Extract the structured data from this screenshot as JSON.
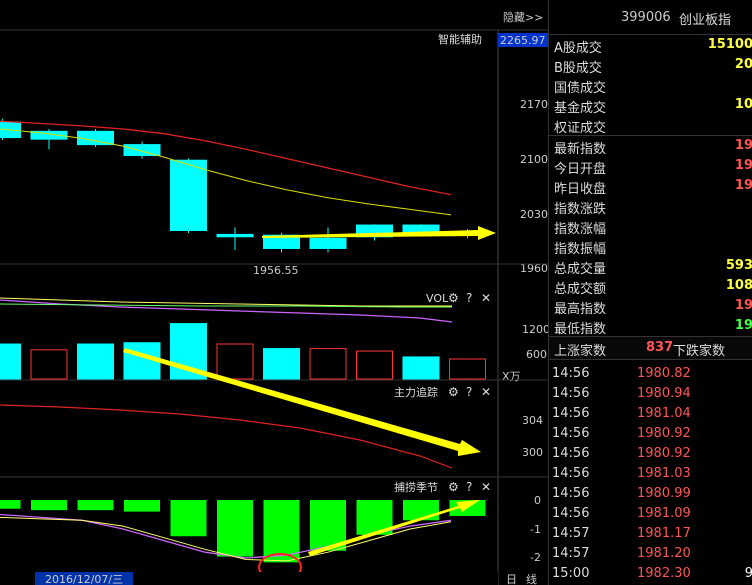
{
  "top": {
    "hide_label": "隐藏>>"
  },
  "main_panel": {
    "title": "智能辅助",
    "price_badge": "2265.97",
    "y_ticks": [
      "2170",
      "2100",
      "2030",
      "1960"
    ],
    "low_label": "1956.55"
  },
  "vol_panel": {
    "title": "VOL",
    "y_ticks": [
      "1200",
      "600"
    ],
    "unit": "X万"
  },
  "track_panel": {
    "title": "主力追踪",
    "y_ticks": [
      "304",
      "300"
    ]
  },
  "season_panel": {
    "title": "捕捞季节",
    "y_ticks": [
      "0",
      "-1",
      "-2"
    ]
  },
  "bottom": {
    "date_label": "2016/12/07/三",
    "tab_day": "日",
    "tab_line": "线"
  },
  "icons": {
    "gear": "gear-icon",
    "help": "help-icon",
    "close": "close-icon"
  },
  "info": {
    "code": "399006",
    "name": "创业板指",
    "stats_a": [
      {
        "label": "A股成交",
        "value": "15100"
      },
      {
        "label": "B股成交",
        "value": "20"
      },
      {
        "label": "国债成交",
        "value": ""
      },
      {
        "label": "基金成交",
        "value": "10"
      },
      {
        "label": "权证成交",
        "value": ""
      }
    ],
    "stats_b": [
      {
        "label": "最新指数",
        "value": "19"
      },
      {
        "label": "今日开盘",
        "value": "19"
      },
      {
        "label": "昨日收盘",
        "value": "19"
      },
      {
        "label": "指数涨跌",
        "value": ""
      },
      {
        "label": "指数涨幅",
        "value": ""
      },
      {
        "label": "指数振幅",
        "value": ""
      },
      {
        "label": "总成交量",
        "value": "593"
      },
      {
        "label": "总成交额",
        "value": "108"
      },
      {
        "label": "最高指数",
        "value": "19"
      },
      {
        "label": "最低指数",
        "value": "19"
      }
    ],
    "up_label": "上涨家数",
    "up_value": "837",
    "down_label": "下跌家数",
    "ticks": [
      {
        "time": "14:56",
        "price": "1980.82",
        "vol": ""
      },
      {
        "time": "14:56",
        "price": "1980.94",
        "vol": ""
      },
      {
        "time": "14:56",
        "price": "1981.04",
        "vol": ""
      },
      {
        "time": "14:56",
        "price": "1980.92",
        "vol": ""
      },
      {
        "time": "14:56",
        "price": "1980.92",
        "vol": ""
      },
      {
        "time": "14:56",
        "price": "1981.03",
        "vol": ""
      },
      {
        "time": "14:56",
        "price": "1980.99",
        "vol": ""
      },
      {
        "time": "14:56",
        "price": "1981.09",
        "vol": ""
      },
      {
        "time": "14:57",
        "price": "1981.17",
        "vol": ""
      },
      {
        "time": "14:57",
        "price": "1981.20",
        "vol": ""
      },
      {
        "time": "15:00",
        "price": "1982.30",
        "vol": "9"
      }
    ]
  },
  "chart_data": {
    "type": "candlestick",
    "series": [
      {
        "open": 2147,
        "close": 2127,
        "high": 2151,
        "low": 2124
      },
      {
        "open": 2135,
        "close": 2125,
        "high": 2138,
        "low": 2112
      },
      {
        "open": 2135,
        "close": 2118,
        "high": 2138,
        "low": 2115
      },
      {
        "open": 2118,
        "close": 2104,
        "high": 2122,
        "low": 2100
      },
      {
        "open": 2098,
        "close": 2008,
        "high": 2100,
        "low": 2005
      },
      {
        "open": 2003,
        "close": 2000,
        "high": 2012,
        "low": 1983
      },
      {
        "open": 2002,
        "close": 1985,
        "high": 2005,
        "low": 1980
      },
      {
        "open": 1998,
        "close": 1985,
        "high": 2012,
        "low": 1980
      },
      {
        "open": 2015,
        "close": 2000,
        "high": 2016,
        "low": 1995
      },
      {
        "open": 2015,
        "close": 2004,
        "high": 2016,
        "low": 2002
      },
      {
        "open": 2004,
        "close": 2003,
        "high": 2010,
        "low": 1998
      }
    ],
    "ma_red": [
      2148,
      2145,
      2142,
      2138,
      2132,
      2123,
      2112,
      2100,
      2088,
      2076,
      2064,
      2054
    ],
    "ma_yellow": [
      2138,
      2133,
      2126,
      2116,
      2102,
      2086,
      2072,
      2060,
      2050,
      2042,
      2035,
      2028
    ],
    "volume": {
      "bars": [
        {
          "value": 840,
          "up": false
        },
        {
          "value": 700,
          "up": true
        },
        {
          "value": 840,
          "up": false
        },
        {
          "value": 870,
          "up": false
        },
        {
          "value": 1330,
          "up": false
        },
        {
          "value": 840,
          "up": true
        },
        {
          "value": 730,
          "up": false
        },
        {
          "value": 730,
          "up": true
        },
        {
          "value": 670,
          "up": true
        },
        {
          "value": 530,
          "up": false
        },
        {
          "value": 480,
          "up": true
        }
      ]
    },
    "season": {
      "bars": [
        -0.3,
        -0.35,
        -0.35,
        -0.4,
        -1.25,
        -1.95,
        -2.15,
        -1.75,
        -1.2,
        -0.7,
        -0.55
      ],
      "line_purple": [
        -0.5,
        -0.6,
        -0.7,
        -1.0,
        -1.4,
        -1.8,
        -2.0,
        -1.9,
        -1.6,
        -1.2,
        -0.9,
        -0.7
      ],
      "line_yellow": [
        -0.6,
        -0.65,
        -0.7,
        -0.9,
        -1.3,
        -1.7,
        -2.05,
        -2.1,
        -1.8,
        -1.4,
        -1.0,
        -0.75
      ]
    }
  }
}
